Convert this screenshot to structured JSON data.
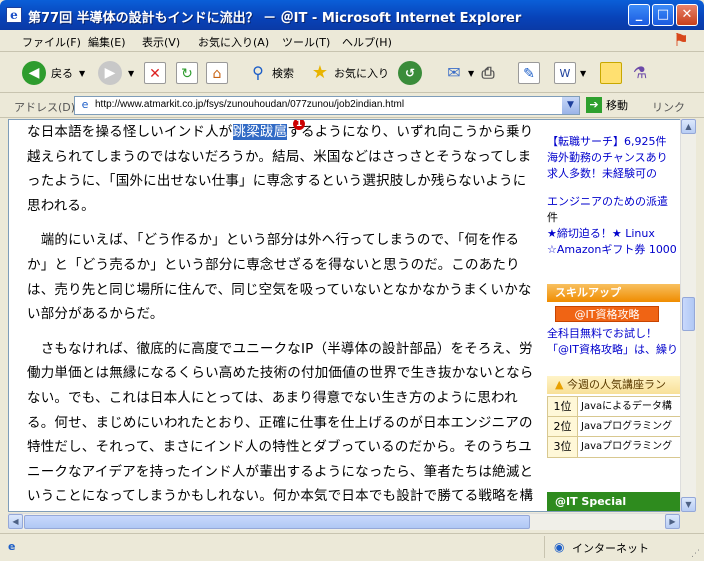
{
  "window": {
    "title": "第77回 半導体の設計もインドに流出？ － ＠IT - Microsoft Internet Explorer",
    "minimize": "_",
    "maximize": "□",
    "close": "✕"
  },
  "menu": {
    "items": [
      "ファイル(F)",
      "編集(E)",
      "表示(V)",
      "お気に入り(A)",
      "ツール(T)",
      "ヘルプ(H)"
    ]
  },
  "toolbar": {
    "back_label": "戻る",
    "search_label": "検索",
    "favorites_label": "お気に入り"
  },
  "address": {
    "label": "アドレス(D)",
    "url": "http://www.atmarkit.co.jp/fsys/zunouhoudan/077zunou/job2indian.html",
    "go_label": "移動",
    "links_label": "リンク"
  },
  "article": {
    "p1_a": "な日本語を操る怪しいインド人が",
    "p1_hl": "跳梁跋扈",
    "p1_b": "するようになり、いずれ向こうから乗り越えられてしまうのではないだろうか。結局、米国などはさっさとそうなってしまったように、「国外に出せない仕事」に専念するという選択肢しか残らないように思われる。",
    "p2": "　端的にいえば、「どう作るか」という部分は外へ行ってしまうので、「何を作るか」と「どう売るか」という部分に専念せざるを得ないと思うのだ。このあたりは、売り先と同じ場所に住んで、同じ空気を吸っていないとなかなかうまくいかない部分があるからだ。",
    "p3": "　さもなければ、徹底的に高度でユニークなIP（半導体の設計部品）をそろえ、労働力単価とは無縁になるくらい高めた技術の付加価値の世界で生き抜かないとならない。でも、これは日本人にとっては、あまり得意でない生き方のように思われる。何せ、まじめにいわれたとおり、正確に仕事を仕上げるのが日本エンジニアの特性だし、それって、まさにインド人の特性とダブっているのだから。そのうちユニークなアイデアを持ったインド人が輩出するようになったら、筆者たちは絶滅ということになってしまうかもしれない。何か本気で日本でも設計で勝てる戦略を構築しないといけない。",
    "marker": "1"
  },
  "sidebar": {
    "ad1_title": "【転職サーチ】6,925件",
    "ad1_line2": "海外勤務のチャンスあり",
    "ad1_line3": "求人多数！未経験可の",
    "ad2_line1": "エンジニアのための派遣",
    "ad2_line2": "件",
    "ad2_line3": "★締切迫る！★ Linux",
    "ad2_line4": "☆Amazonギフト券 1000",
    "skillup_header": "スキルアップ",
    "skillup_button": "@IT資格攻略",
    "skillup_line1": "全科目無料でお試し！",
    "skillup_line2": "「@IT資格攻略」は、繰り",
    "ranking_header": "今週の人気講座ラン",
    "ranking": [
      {
        "rank": "1位",
        "title": "Javaによるデータ構"
      },
      {
        "rank": "2位",
        "title": "Javaプログラミング"
      },
      {
        "rank": "3位",
        "title": "Javaプログラミング"
      }
    ],
    "special_header": "@IT Special"
  },
  "status": {
    "zone": "インターネット"
  },
  "colors": {
    "title_blue": "#0842b8",
    "selection": "#316ac5",
    "accent_red": "#cc0000",
    "skill_orange": "#f08c00",
    "special_green": "#2e8b1e"
  }
}
